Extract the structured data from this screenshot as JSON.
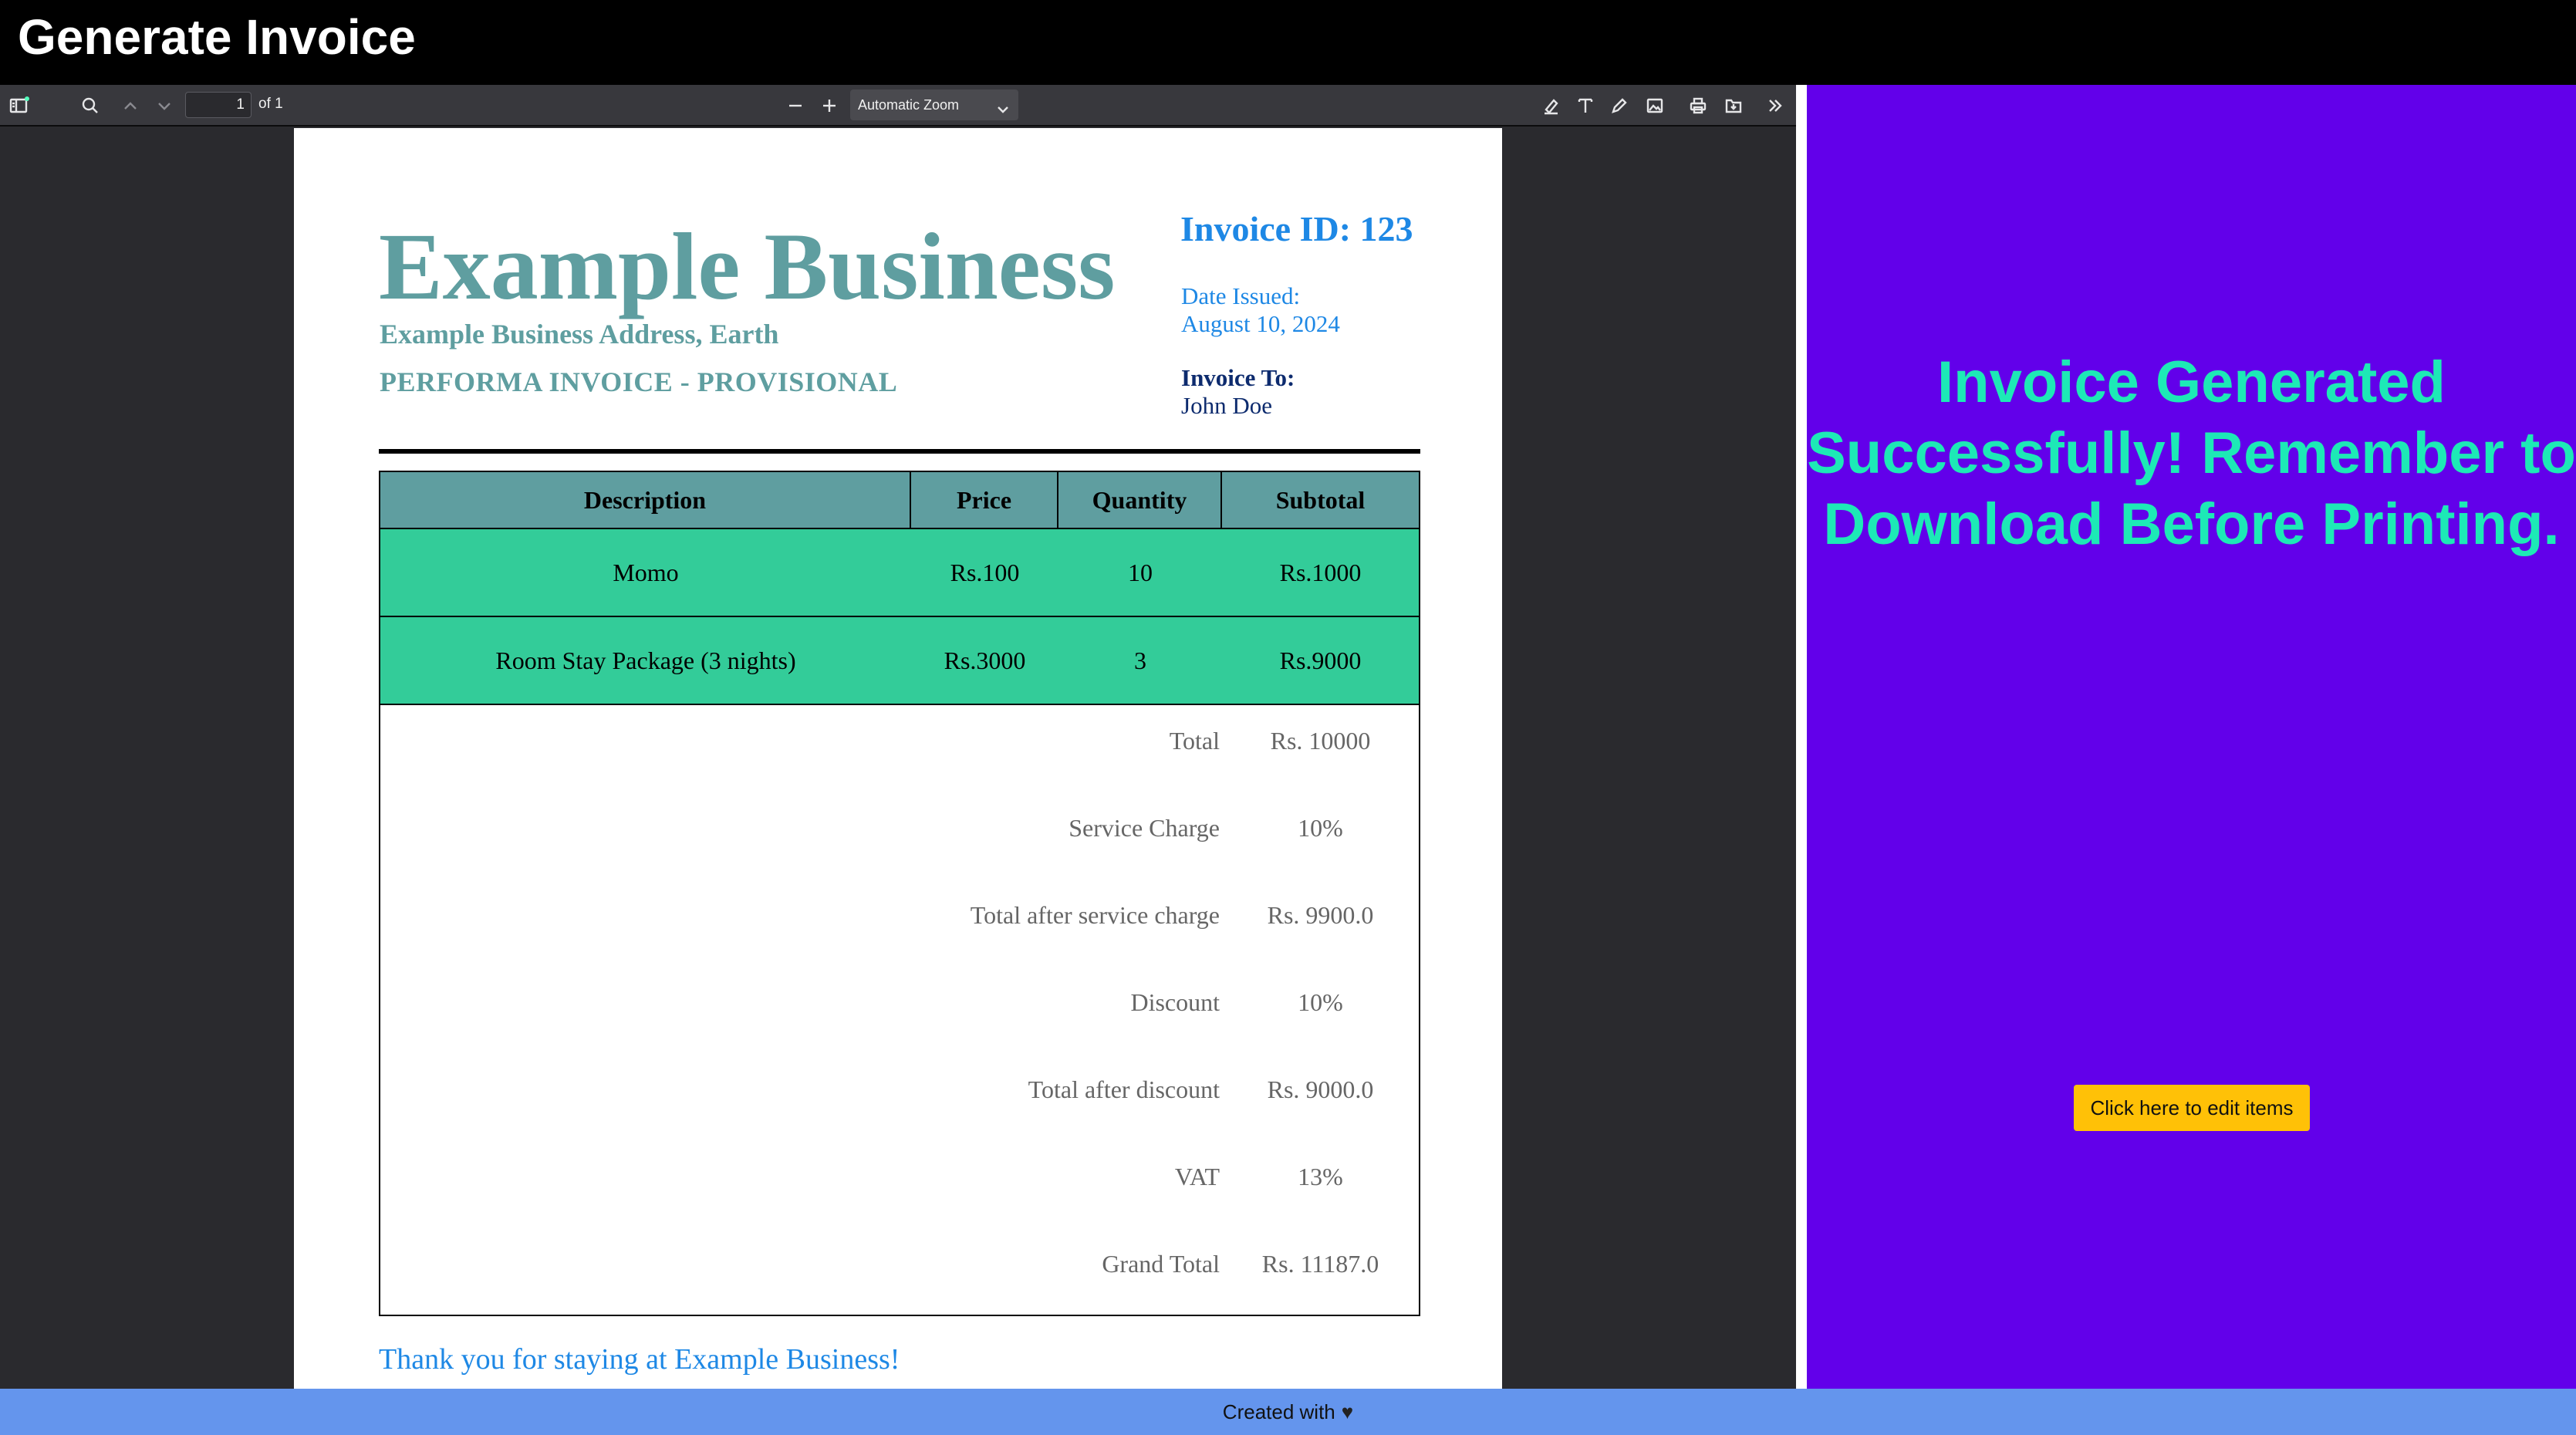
{
  "app": {
    "title": "Generate Invoice"
  },
  "viewer": {
    "page_current": "1",
    "page_total": "of 1",
    "zoom": "Automatic Zoom"
  },
  "invoice": {
    "business_name": "Example Business",
    "business_address": "Example Business Address, Earth",
    "invoice_type": "PERFORMA INVOICE - PROVISIONAL",
    "invoice_id": "Invoice ID: 123",
    "date_label": "Date Issued:",
    "date_value": "August 10, 2024",
    "to_label": "Invoice To:",
    "to_value": "John Doe",
    "columns": [
      "Description",
      "Price",
      "Quantity",
      "Subtotal"
    ],
    "items": [
      {
        "description": "Momo",
        "price": "Rs.100",
        "quantity": "10",
        "subtotal": "Rs.1000"
      },
      {
        "description": "Room Stay Package (3 nights)",
        "price": "Rs.3000",
        "quantity": "3",
        "subtotal": "Rs.9000"
      }
    ],
    "summary": [
      {
        "label": "Total",
        "value": "Rs. 10000"
      },
      {
        "label": "Service Charge",
        "value": "10%"
      },
      {
        "label": "Total after service charge",
        "value": "Rs. 9900.0"
      },
      {
        "label": "Discount",
        "value": "10%"
      },
      {
        "label": "Total after discount",
        "value": "Rs. 9000.0"
      },
      {
        "label": "VAT",
        "value": "13%"
      },
      {
        "label": "Grand Total",
        "value": "Rs. 11187.0"
      }
    ],
    "thanks": "Thank you for staying at Example Business!"
  },
  "side": {
    "message": "Invoice Generated Successfully! Remember to Download Before Printing.",
    "edit_button": "Click here to edit items"
  },
  "footer": {
    "text": "Created with"
  },
  "colors": {
    "brand_teal": "#5f9ea0",
    "row_green": "#33cc99",
    "side_bg": "#6200ea",
    "side_text": "#1de9b6",
    "button": "#ffc107",
    "footer_bg": "#6495ed"
  },
  "icons": [
    "sidebar-toggle-icon",
    "search-icon",
    "chevron-up-icon",
    "chevron-down-icon",
    "zoom-out-icon",
    "zoom-in-icon",
    "highlight-icon",
    "text-icon",
    "draw-icon",
    "image-icon",
    "print-icon",
    "save-icon",
    "double-chevron-right-icon",
    "heart-icon"
  ]
}
